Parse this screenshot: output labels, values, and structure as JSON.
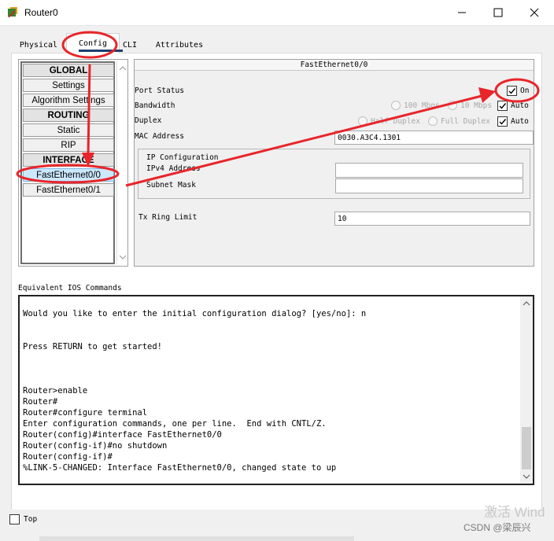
{
  "window": {
    "title": "Router0",
    "minimize_icon": "minimize-icon",
    "maximize_icon": "maximize-icon",
    "close_icon": "close-icon"
  },
  "tabs": [
    {
      "label": "Physical"
    },
    {
      "label": "Config",
      "active": true
    },
    {
      "label": "CLI"
    },
    {
      "label": "Attributes"
    }
  ],
  "sidebar": {
    "items": [
      {
        "label": "GLOBAL",
        "kind": "header"
      },
      {
        "label": "Settings"
      },
      {
        "label": "Algorithm Settings"
      },
      {
        "label": "ROUTING",
        "kind": "header"
      },
      {
        "label": "Static"
      },
      {
        "label": "RIP"
      },
      {
        "label": "INTERFACE",
        "kind": "header"
      },
      {
        "label": "FastEthernet0/0",
        "selected": true
      },
      {
        "label": "FastEthernet0/1"
      }
    ]
  },
  "interface_panel": {
    "title": "FastEthernet0/0",
    "port_status_label": "Port Status",
    "port_status_on_label": "On",
    "port_status_on": true,
    "bandwidth_label": "Bandwidth",
    "bandwidth_100": "100 Mbps",
    "bandwidth_10": "10 Mbps",
    "bandwidth_auto_label": "Auto",
    "bandwidth_auto": true,
    "duplex_label": "Duplex",
    "duplex_half": "Half Duplex",
    "duplex_full": "Full Duplex",
    "duplex_auto_label": "Auto",
    "duplex_auto": true,
    "mac_label": "MAC Address",
    "mac_value": "0030.A3C4.1301",
    "ip_config_label": "IP Configuration",
    "ipv4_label": "IPv4 Address",
    "ipv4_value": "",
    "subnet_label": "Subnet Mask",
    "subnet_value": "",
    "tx_ring_label": "Tx Ring Limit",
    "tx_ring_value": "10"
  },
  "console": {
    "label": "Equivalent IOS Commands",
    "lines": [
      "Would you like to enter the initial configuration dialog? [yes/no]: n",
      "",
      "",
      "Press RETURN to get started!",
      "",
      "",
      "",
      "",
      "Router>enable",
      "Router#",
      "Router#configure terminal",
      "Enter configuration commands, one per line.  End with CNTL/Z.",
      "Router(config)#interface FastEthernet0/0",
      "Router(config-if)#no shutdown",
      "Router(config-if)#",
      "%LINK-5-CHANGED: Interface FastEthernet0/0, changed state to up"
    ]
  },
  "footer": {
    "top_label": "Top",
    "top_checked": false
  },
  "watermark": {
    "activate": "激活 Wind",
    "csdn": "CSDN @梁辰兴"
  },
  "colors": {
    "annotation_red": "#e8252a",
    "selected_bg": "#cce8ff",
    "tab_underline": "#1e3e6e"
  }
}
